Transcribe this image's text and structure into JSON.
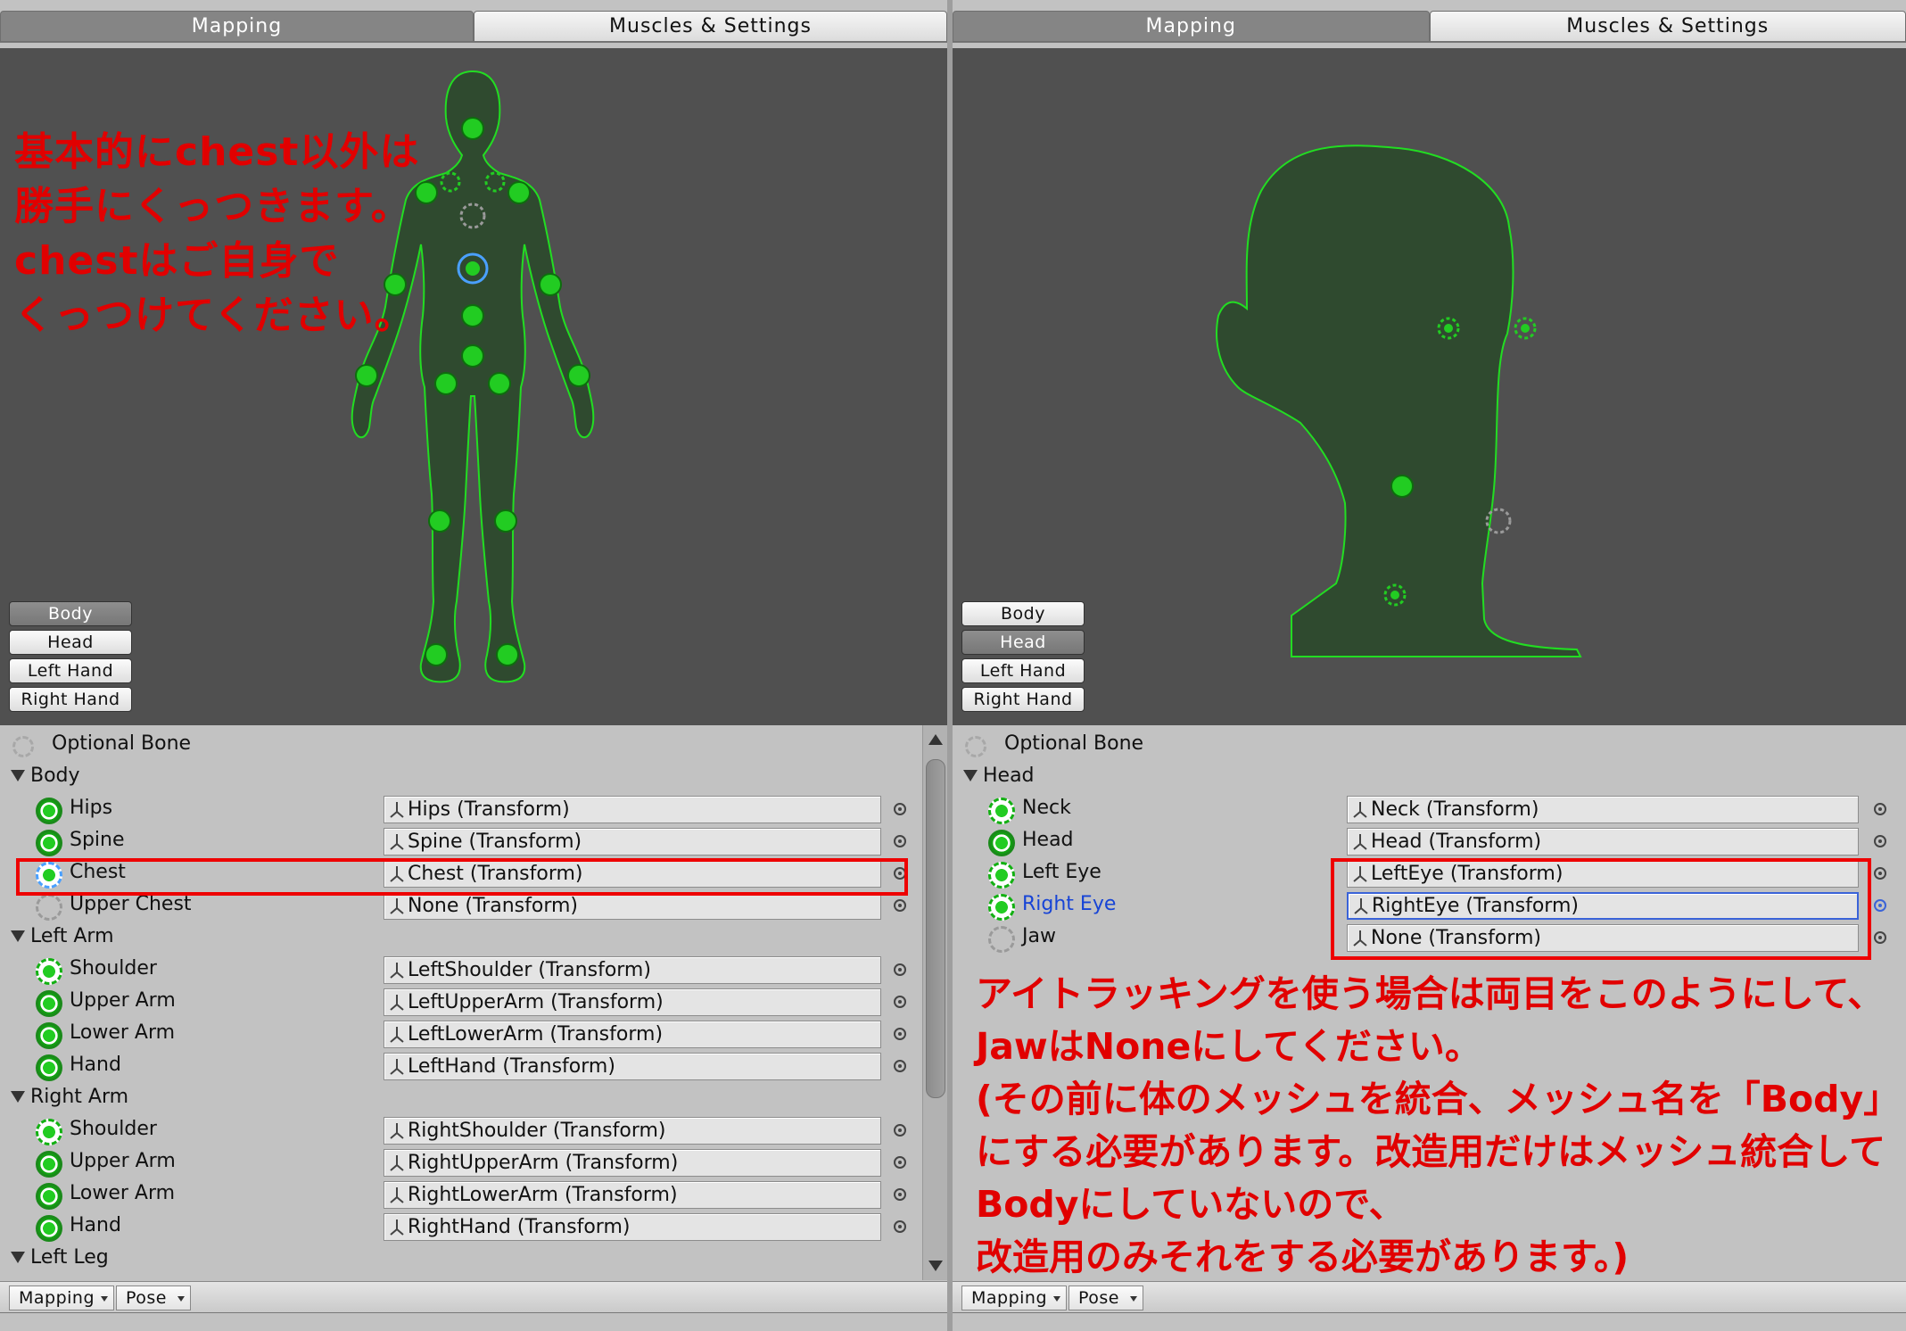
{
  "left": {
    "tabs": {
      "mapping": "Mapping",
      "muscles": "Muscles & Settings"
    },
    "view_buttons": [
      "Body",
      "Head",
      "Left Hand",
      "Right Hand"
    ],
    "active_view": "Body",
    "note_lines": [
      "基本的にchest以外は",
      "勝手にくっつきます。",
      "chestはご自身で",
      "くっつけてください。"
    ],
    "optional_bone_label": "Optional Bone",
    "groups": [
      {
        "label": "Body",
        "bones": [
          {
            "name": "Hips",
            "value": "Hips (Transform)",
            "icon": "solid"
          },
          {
            "name": "Spine",
            "value": "Spine (Transform)",
            "icon": "solid"
          },
          {
            "name": "Chest",
            "value": "Chest (Transform)",
            "icon": "selected"
          },
          {
            "name": "Upper Chest",
            "value": "None (Transform)",
            "icon": "dashed-gray"
          }
        ]
      },
      {
        "label": "Left Arm",
        "bones": [
          {
            "name": "Shoulder",
            "value": "LeftShoulder (Transform)",
            "icon": "dashed-green"
          },
          {
            "name": "Upper Arm",
            "value": "LeftUpperArm (Transform)",
            "icon": "solid"
          },
          {
            "name": "Lower Arm",
            "value": "LeftLowerArm (Transform)",
            "icon": "solid"
          },
          {
            "name": "Hand",
            "value": "LeftHand (Transform)",
            "icon": "solid"
          }
        ]
      },
      {
        "label": "Right Arm",
        "bones": [
          {
            "name": "Shoulder",
            "value": "RightShoulder (Transform)",
            "icon": "dashed-green"
          },
          {
            "name": "Upper Arm",
            "value": "RightUpperArm (Transform)",
            "icon": "solid"
          },
          {
            "name": "Lower Arm",
            "value": "RightLowerArm (Transform)",
            "icon": "solid"
          },
          {
            "name": "Hand",
            "value": "RightHand (Transform)",
            "icon": "solid"
          }
        ]
      },
      {
        "label": "Left Leg",
        "bones": []
      }
    ],
    "bottom": {
      "mapping": "Mapping",
      "pose": "Pose"
    }
  },
  "right": {
    "tabs": {
      "mapping": "Mapping",
      "muscles": "Muscles & Settings"
    },
    "view_buttons": [
      "Body",
      "Head",
      "Left Hand",
      "Right Hand"
    ],
    "active_view": "Head",
    "optional_bone_label": "Optional Bone",
    "groups": [
      {
        "label": "Head",
        "bones": [
          {
            "name": "Neck",
            "value": "Neck (Transform)",
            "icon": "dashed-green"
          },
          {
            "name": "Head",
            "value": "Head (Transform)",
            "icon": "solid"
          },
          {
            "name": "Left Eye",
            "value": "LeftEye (Transform)",
            "icon": "dashed-green"
          },
          {
            "name": "Right Eye",
            "value": "RightEye (Transform)",
            "icon": "dashed-green",
            "selected": true
          },
          {
            "name": "Jaw",
            "value": "None (Transform)",
            "icon": "dashed-gray"
          }
        ]
      }
    ],
    "note_lines": [
      "アイトラッキングを使う場合は両目をこのようにして、",
      "JawはNoneにしてください。",
      "(その前に体のメッシュを統合、メッシュ名を「Body」",
      "にする必要があります。改造用だけはメッシュ統合して",
      "Bodyにしていないので、",
      "改造用のみそれをする必要があります。)"
    ],
    "bottom": {
      "mapping": "Mapping",
      "pose": "Pose"
    }
  },
  "colors": {
    "bone_green": "#22cc22",
    "selected_blue": "#1744d6",
    "annotation_red": "#e10000",
    "viewport_bg": "#505050"
  }
}
